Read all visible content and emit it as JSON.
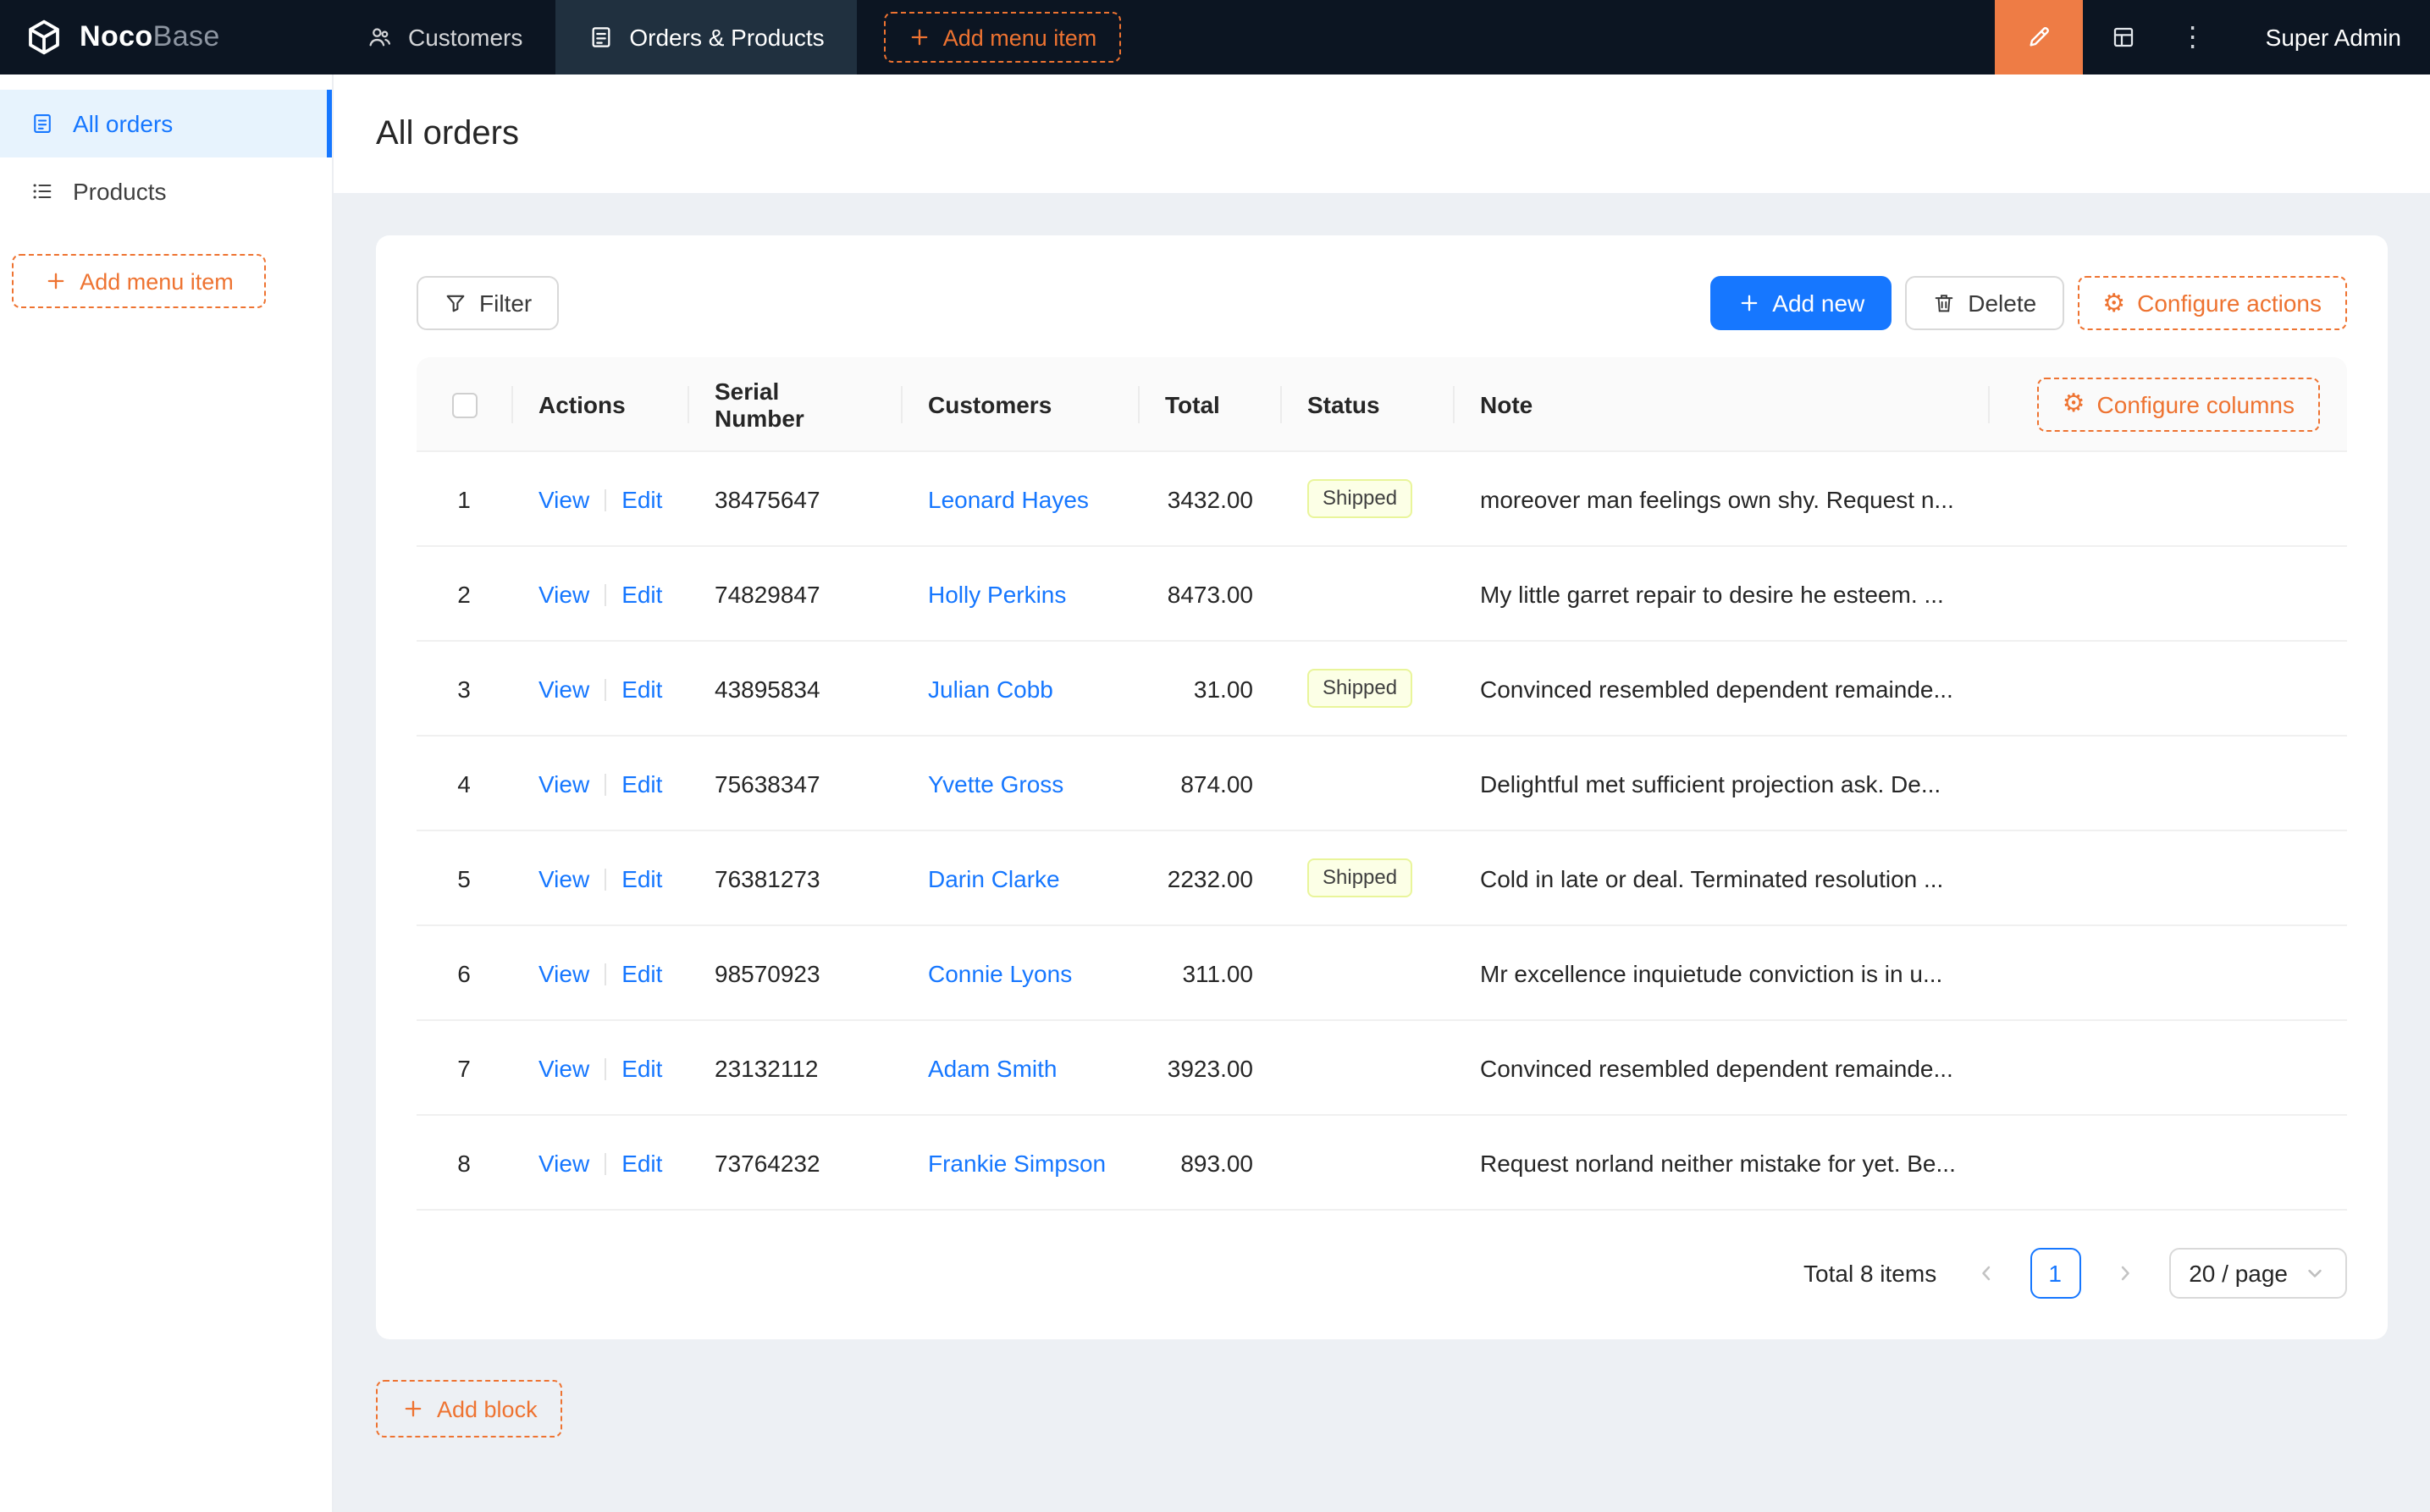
{
  "colors": {
    "accent_orange": "#ee7331",
    "designer_button_bg": "#ee7c45",
    "primary_blue": "#1677ff",
    "navbar_bg": "#0c1522",
    "sidebar_active_bg": "#e7f3fd",
    "status_tag_bg": "#fcffe6",
    "status_tag_border": "#e9f59a"
  },
  "icons": {
    "gear": "⚙",
    "kebab": "⋮"
  },
  "navbar": {
    "logo_noco": "Noco",
    "logo_base": "Base",
    "menu": [
      {
        "label": "Customers"
      },
      {
        "label": "Orders & Products"
      }
    ],
    "add_menu_item_label": "Add menu item",
    "user": "Super Admin"
  },
  "sidebar": {
    "items": [
      {
        "label": "All orders"
      },
      {
        "label": "Products"
      }
    ],
    "add_menu_item_label": "Add menu item"
  },
  "page": {
    "title": "All orders"
  },
  "toolbar": {
    "filter_label": "Filter",
    "add_new_label": "Add new",
    "delete_label": "Delete",
    "configure_actions_label": "Configure actions"
  },
  "table": {
    "configure_columns_label": "Configure columns",
    "columns": [
      "Actions",
      "Serial Number",
      "Customers",
      "Total",
      "Status",
      "Note"
    ],
    "action_labels": {
      "view": "View",
      "edit": "Edit"
    },
    "rows": [
      {
        "index": "1",
        "serial": "38475647",
        "customer": "Leonard Hayes",
        "total": "3432.00",
        "status": "Shipped",
        "note": "moreover man feelings own shy. Request n..."
      },
      {
        "index": "2",
        "serial": "74829847",
        "customer": "Holly Perkins",
        "total": "8473.00",
        "status": "",
        "note": "My little garret repair to desire he esteem. ..."
      },
      {
        "index": "3",
        "serial": "43895834",
        "customer": "Julian Cobb",
        "total": "31.00",
        "status": "Shipped",
        "note": "Convinced resembled dependent remainde..."
      },
      {
        "index": "4",
        "serial": "75638347",
        "customer": "Yvette Gross",
        "total": "874.00",
        "status": "",
        "note": "Delightful met sufficient projection ask. De..."
      },
      {
        "index": "5",
        "serial": "76381273",
        "customer": "Darin Clarke",
        "total": "2232.00",
        "status": "Shipped",
        "note": "Cold in late or deal. Terminated resolution ..."
      },
      {
        "index": "6",
        "serial": "98570923",
        "customer": "Connie Lyons",
        "total": "311.00",
        "status": "",
        "note": "Mr excellence inquietude conviction is in u..."
      },
      {
        "index": "7",
        "serial": "23132112",
        "customer": "Adam Smith",
        "total": "3923.00",
        "status": "",
        "note": "Convinced resembled dependent remainde..."
      },
      {
        "index": "8",
        "serial": "73764232",
        "customer": "Frankie Simpson",
        "total": "893.00",
        "status": "",
        "note": "Request norland neither mistake for yet. Be..."
      }
    ]
  },
  "pagination": {
    "total_text": "Total 8 items",
    "current_page": "1",
    "page_size": "20 / page"
  },
  "footer": {
    "add_block_label": "Add block"
  }
}
